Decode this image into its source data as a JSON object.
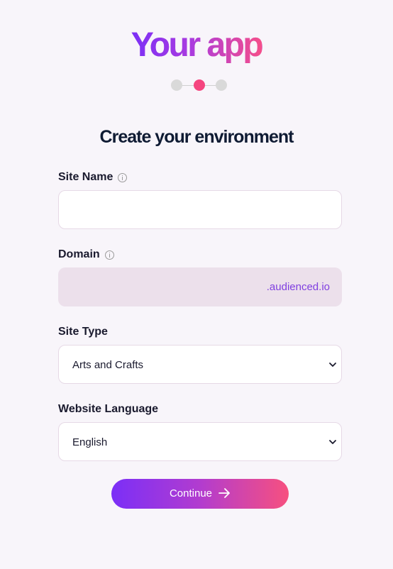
{
  "app": {
    "logo_part1": "Your",
    "logo_part2": "app"
  },
  "stepper": {
    "total_steps": 3,
    "current_step": 2
  },
  "form": {
    "heading": "Create your environment",
    "site_name": {
      "label": "Site Name",
      "value": ""
    },
    "domain": {
      "label": "Domain",
      "suffix": ".audienced.io",
      "value": ""
    },
    "site_type": {
      "label": "Site Type",
      "selected": "Arts and Crafts"
    },
    "website_language": {
      "label": "Website Language",
      "selected": "English"
    },
    "continue_label": "Continue"
  },
  "colors": {
    "accent_purple": "#7b2ff7",
    "accent_pink": "#f7507f",
    "domain_bg": "#ece0eb",
    "domain_suffix": "#7f3fe0",
    "step_active": "#f5457f",
    "step_inactive": "#d9d9d9"
  },
  "icons": {
    "info": "info-icon",
    "chevron": "chevron-down-icon",
    "arrow": "arrow-right-icon"
  }
}
